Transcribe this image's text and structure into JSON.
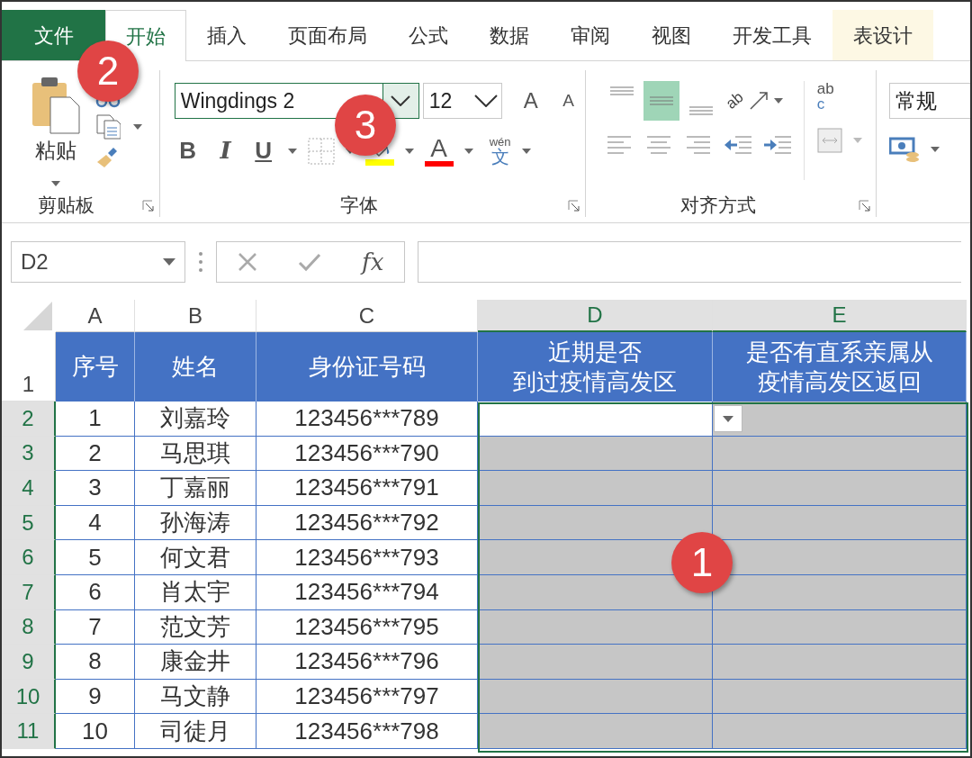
{
  "tabs": [
    {
      "label": "文件",
      "kind": "file",
      "selected": false
    },
    {
      "label": "开始",
      "kind": "normal",
      "selected": true
    },
    {
      "label": "插入",
      "kind": "normal",
      "selected": false
    },
    {
      "label": "页面布局",
      "kind": "normal",
      "selected": false
    },
    {
      "label": "公式",
      "kind": "normal",
      "selected": false
    },
    {
      "label": "数据",
      "kind": "normal",
      "selected": false
    },
    {
      "label": "审阅",
      "kind": "normal",
      "selected": false
    },
    {
      "label": "视图",
      "kind": "normal",
      "selected": false
    },
    {
      "label": "开发工具",
      "kind": "normal",
      "selected": false
    },
    {
      "label": "表设计",
      "kind": "context",
      "selected": false
    }
  ],
  "clipboard": {
    "paste_label": "粘贴",
    "group_label": "剪贴板"
  },
  "font": {
    "font_name": "Wingdings 2",
    "font_size": "12",
    "bold": "B",
    "italic": "I",
    "underline": "U",
    "grow": "A",
    "shrink": "A",
    "font_color": "A",
    "phonetic_top": "wén",
    "phonetic_char": "文",
    "group_label": "字体"
  },
  "alignment": {
    "vertical": [
      {
        "selected": false
      },
      {
        "selected": true
      },
      {
        "selected": false
      }
    ],
    "orientation_text": "ab",
    "wrap_text_top": "ab",
    "wrap_text_bottom": "c",
    "group_label": "对齐方式"
  },
  "number": {
    "format": "常规"
  },
  "formula_bar": {
    "name_box": "D2",
    "fx": "fx"
  },
  "sheet": {
    "columns": [
      {
        "label": "A",
        "selected": false
      },
      {
        "label": "B",
        "selected": false
      },
      {
        "label": "C",
        "selected": false
      },
      {
        "label": "D",
        "selected": true
      },
      {
        "label": "E",
        "selected": true
      }
    ],
    "header_row": {
      "number": "1",
      "cells": [
        [
          "序号"
        ],
        [
          "姓名"
        ],
        [
          "身份证号码"
        ],
        [
          "近期是否",
          "到过疫情高发区"
        ],
        [
          "是否有直系亲属从",
          "疫情高发区返回"
        ]
      ]
    },
    "rows": [
      {
        "number": "2",
        "cells": [
          "1",
          "刘嘉玲",
          "123456***789"
        ],
        "selected": true
      },
      {
        "number": "3",
        "cells": [
          "2",
          "马思琪",
          "123456***790"
        ],
        "selected": true
      },
      {
        "number": "4",
        "cells": [
          "3",
          "丁嘉丽",
          "123456***791"
        ],
        "selected": true
      },
      {
        "number": "5",
        "cells": [
          "4",
          "孙海涛",
          "123456***792"
        ],
        "selected": true
      },
      {
        "number": "6",
        "cells": [
          "5",
          "何文君",
          "123456***793"
        ],
        "selected": true
      },
      {
        "number": "7",
        "cells": [
          "6",
          "肖太宇",
          "123456***794"
        ],
        "selected": true
      },
      {
        "number": "8",
        "cells": [
          "7",
          "范文芳",
          "123456***795"
        ],
        "selected": true
      },
      {
        "number": "9",
        "cells": [
          "8",
          "康金井",
          "123456***796"
        ],
        "selected": true
      },
      {
        "number": "10",
        "cells": [
          "9",
          "马文静",
          "123456***797"
        ],
        "selected": true
      },
      {
        "number": "11",
        "cells": [
          "10",
          "司徒月",
          "123456***798"
        ],
        "selected": true
      }
    ]
  },
  "callouts": [
    {
      "label": "2"
    },
    {
      "label": "3"
    },
    {
      "label": "1"
    }
  ]
}
